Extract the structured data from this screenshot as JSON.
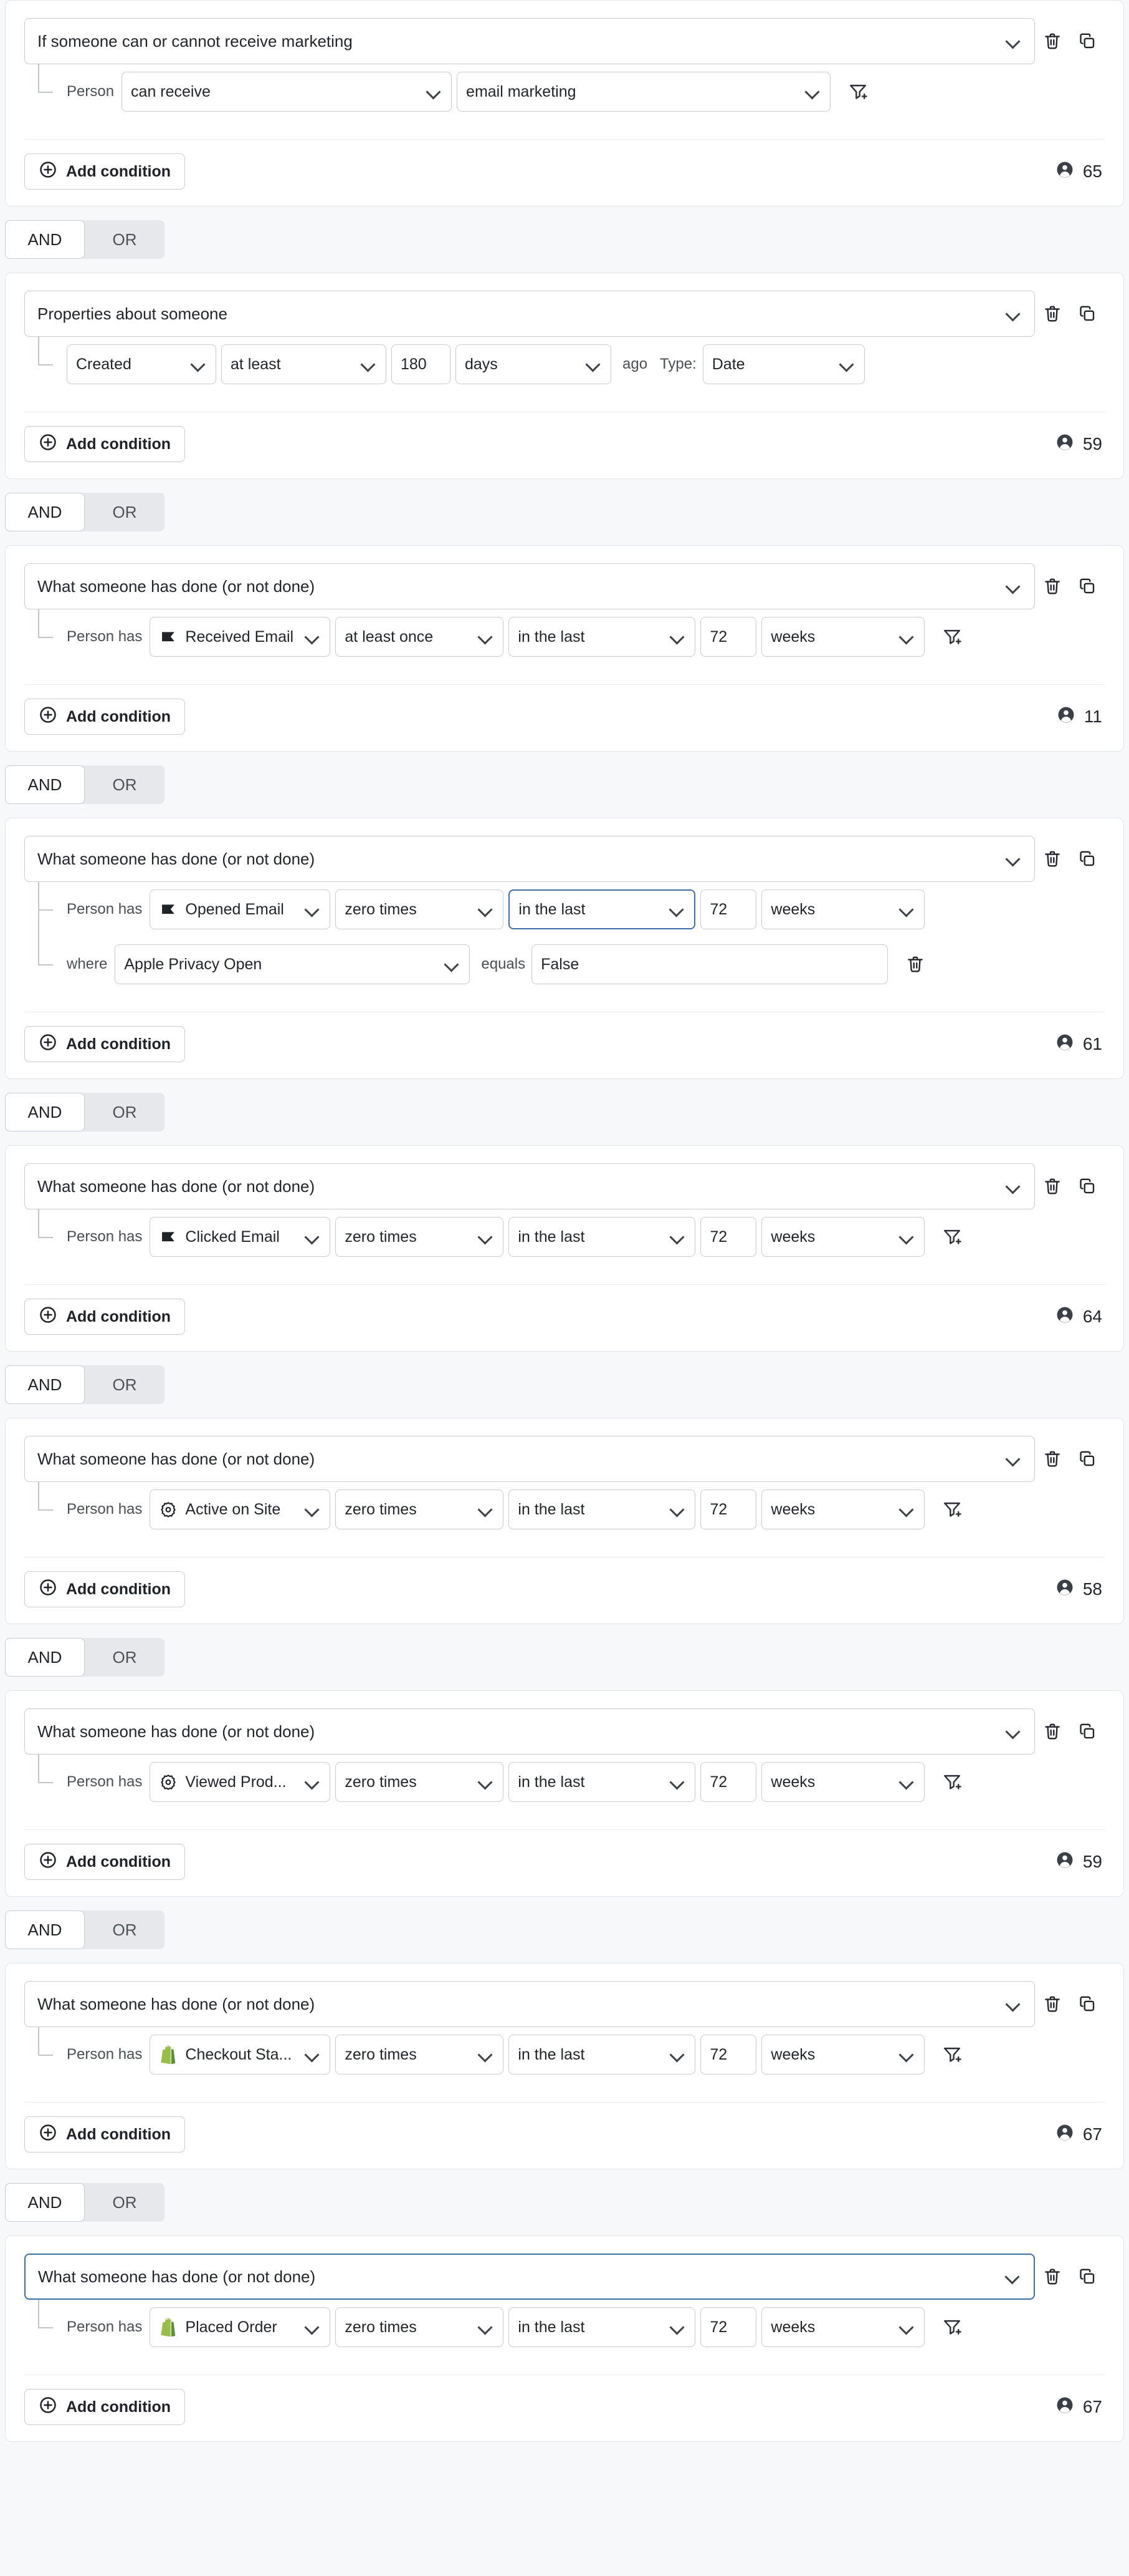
{
  "labels": {
    "add_condition": "Add condition",
    "person": "Person",
    "person_has": "Person has",
    "where": "where",
    "equals": "equals",
    "ago": "ago",
    "type": "Type:",
    "and": "AND",
    "or": "OR"
  },
  "icons": {
    "trash": "trash-icon",
    "duplicate": "duplicate-icon",
    "filter_add": "filter-add-icon",
    "person_count": "person-count-icon",
    "plus_circle": "plus-circle-icon",
    "chevron_down": "chevron-down-icon",
    "klaviyo_flag": "klaviyo-flag-icon",
    "gear": "gear-icon",
    "shopify": "shopify-icon"
  },
  "colors": {
    "focus_border": "#3f6fa8",
    "shopify_green": "#95bf47",
    "card_border": "#e3e5e8",
    "field_border": "#c9ccd1",
    "page_bg": "#f7f8fa"
  },
  "groups": [
    {
      "type": "marketing",
      "title": "If someone can or cannot receive marketing",
      "title_focused": false,
      "count": "65",
      "rows": [
        {
          "kind": "person-pair",
          "label": "Person",
          "select1": "can receive",
          "select2": "email marketing",
          "tail": "filter-add-icon"
        }
      ]
    },
    {
      "type": "properties",
      "title": "Properties about someone",
      "title_focused": false,
      "count": "59",
      "rows": [
        {
          "kind": "property-date",
          "property": "Created",
          "comparator": "at least",
          "value": "180",
          "unit": "days",
          "ago": "ago",
          "type_label": "Type:",
          "type_value": "Date"
        }
      ]
    },
    {
      "type": "activity",
      "title": "What someone has done (or not done)",
      "title_focused": false,
      "count": "11",
      "rows": [
        {
          "kind": "activity",
          "label": "Person has",
          "icon": "klaviyo-flag-icon",
          "metric": "Received Email",
          "operator": "at least once",
          "timeframe": "in the last",
          "timeframe_focused": false,
          "number": "72",
          "unit": "weeks",
          "tail": "filter-add-icon"
        }
      ]
    },
    {
      "type": "activity",
      "title": "What someone has done (or not done)",
      "title_focused": false,
      "count": "61",
      "rows": [
        {
          "kind": "activity",
          "label": "Person has",
          "icon": "klaviyo-flag-icon",
          "metric": "Opened Email",
          "operator": "zero times",
          "timeframe": "in the last",
          "timeframe_focused": true,
          "number": "72",
          "unit": "weeks",
          "tail": "none"
        },
        {
          "kind": "where",
          "label": "where",
          "property": "Apple Privacy Open",
          "comparator": "equals",
          "value": "False",
          "tail": "trash-icon"
        }
      ]
    },
    {
      "type": "activity",
      "title": "What someone has done (or not done)",
      "title_focused": false,
      "count": "64",
      "rows": [
        {
          "kind": "activity",
          "label": "Person has",
          "icon": "klaviyo-flag-icon",
          "metric": "Clicked Email",
          "operator": "zero times",
          "timeframe": "in the last",
          "timeframe_focused": false,
          "number": "72",
          "unit": "weeks",
          "tail": "filter-add-icon"
        }
      ]
    },
    {
      "type": "activity",
      "title": "What someone has done (or not done)",
      "title_focused": false,
      "count": "58",
      "rows": [
        {
          "kind": "activity",
          "label": "Person has",
          "icon": "gear-icon",
          "metric": "Active on Site",
          "operator": "zero times",
          "timeframe": "in the last",
          "timeframe_focused": false,
          "number": "72",
          "unit": "weeks",
          "tail": "filter-add-icon"
        }
      ]
    },
    {
      "type": "activity",
      "title": "What someone has done (or not done)",
      "title_focused": false,
      "count": "59",
      "rows": [
        {
          "kind": "activity",
          "label": "Person has",
          "icon": "gear-icon",
          "metric": "Viewed Prod...",
          "operator": "zero times",
          "timeframe": "in the last",
          "timeframe_focused": false,
          "number": "72",
          "unit": "weeks",
          "tail": "filter-add-icon"
        }
      ]
    },
    {
      "type": "activity",
      "title": "What someone has done (or not done)",
      "title_focused": false,
      "count": "67",
      "rows": [
        {
          "kind": "activity",
          "label": "Person has",
          "icon": "shopify-icon",
          "metric": "Checkout Sta...",
          "operator": "zero times",
          "timeframe": "in the last",
          "timeframe_focused": false,
          "number": "72",
          "unit": "weeks",
          "tail": "filter-add-icon"
        }
      ]
    },
    {
      "type": "activity",
      "title": "What someone has done (or not done)",
      "title_focused": true,
      "count": "67",
      "rows": [
        {
          "kind": "activity",
          "label": "Person has",
          "icon": "shopify-icon",
          "metric": "Placed Order",
          "operator": "zero times",
          "timeframe": "in the last",
          "timeframe_focused": false,
          "number": "72",
          "unit": "weeks",
          "tail": "filter-add-icon"
        }
      ]
    }
  ],
  "joiners": [
    {
      "selected": "AND"
    },
    {
      "selected": "AND"
    },
    {
      "selected": "AND"
    },
    {
      "selected": "AND"
    },
    {
      "selected": "AND"
    },
    {
      "selected": "AND"
    },
    {
      "selected": "AND"
    },
    {
      "selected": "AND"
    }
  ]
}
